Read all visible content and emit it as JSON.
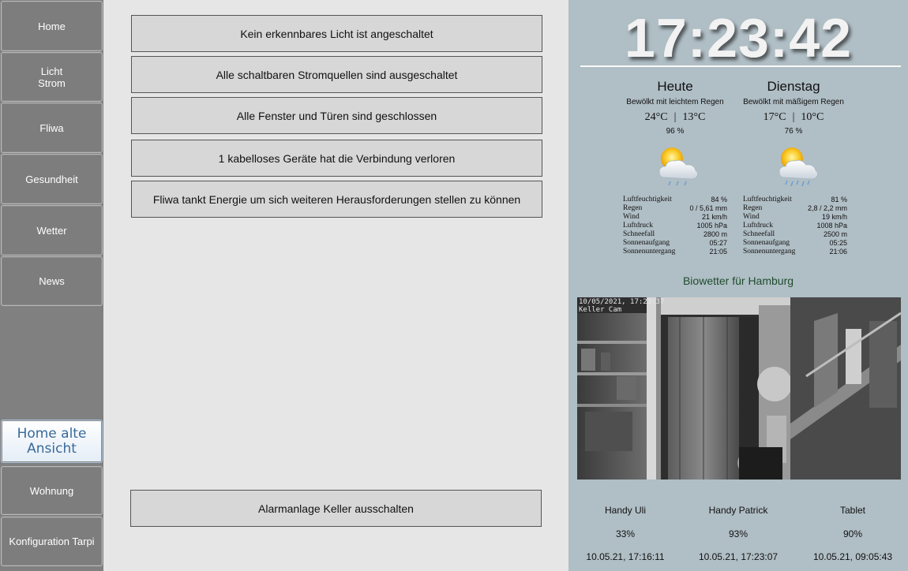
{
  "sidebar": {
    "items": [
      {
        "label": "Home"
      },
      {
        "label": "Licht\nStrom"
      },
      {
        "label": "Fliwa"
      },
      {
        "label": "Gesundheit"
      },
      {
        "label": "Wetter"
      },
      {
        "label": "News"
      },
      {
        "label": "Home alte Ansicht"
      },
      {
        "label": "Wohnung"
      },
      {
        "label": "Konfiguration Tarpi"
      }
    ]
  },
  "status": {
    "messages": [
      "Kein erkennbares Licht ist angeschaltet",
      "Alle schaltbaren Stromquellen sind ausgeschaltet",
      "Alle Fenster und Türen sind geschlossen",
      "1 kabelloses Geräte hat die Verbindung verloren",
      "Fliwa tankt Energie um sich weiteren Herausforderungen stellen zu können"
    ],
    "alarm_button": "Alarmanlage Keller ausschalten"
  },
  "clock": {
    "time": "17:23:42"
  },
  "weather": {
    "days": [
      {
        "name": "Heute",
        "condition": "Bewölkt mit leichtem Regen",
        "temp_high": "24°C",
        "temp_low": "13°C",
        "separator": "|",
        "precip_prob": "96 %",
        "icon": "cloud-sun-rain-icon",
        "details": [
          {
            "label": "Luftfeuchtigkeit",
            "value": "84 %"
          },
          {
            "label": "Regen",
            "value": "0 / 5,61 mm"
          },
          {
            "label": "Wind",
            "value": "21 km/h"
          },
          {
            "label": "Luftdruck",
            "value": "1005 hPa"
          },
          {
            "label": "Schneefall",
            "value": "2800 m"
          },
          {
            "label": "Sonnenaufgang",
            "value": "05:27"
          },
          {
            "label": "Sonnenuntergang",
            "value": "21:05"
          }
        ]
      },
      {
        "name": "Dienstag",
        "condition": "Bewölkt mit mäßigem Regen",
        "temp_high": "17°C",
        "temp_low": "10°C",
        "separator": "|",
        "precip_prob": "76 %",
        "icon": "cloud-sun-heavy-rain-icon",
        "details": [
          {
            "label": "Luftfeuchtigkeit",
            "value": "81 %"
          },
          {
            "label": "Regen",
            "value": "2,8 / 2,2 mm"
          },
          {
            "label": "Wind",
            "value": "19 km/h"
          },
          {
            "label": "Luftdruck",
            "value": "1008 hPa"
          },
          {
            "label": "Schneefall",
            "value": "2500 m"
          },
          {
            "label": "Sonnenaufgang",
            "value": "05:25"
          },
          {
            "label": "Sonnenuntergang",
            "value": "21:06"
          }
        ]
      }
    ],
    "bio_link": "Biowetter für Hamburg"
  },
  "camera": {
    "timestamp": "10/05/2021, 17:23:37",
    "name": "Keller Cam"
  },
  "devices": [
    {
      "name": "Handy Uli",
      "battery": "33%",
      "time": "10.05.21, 17:16:11"
    },
    {
      "name": "Handy Patrick",
      "battery": "93%",
      "time": "10.05.21, 17:23:07"
    },
    {
      "name": "Tablet",
      "battery": "90%",
      "time": "10.05.21, 09:05:43"
    }
  ],
  "colors": {
    "sidebar_bg": "#808080",
    "center_bg": "#e6e6e6",
    "right_bg": "#b0bec5",
    "bio_link": "#1f4d2e"
  }
}
